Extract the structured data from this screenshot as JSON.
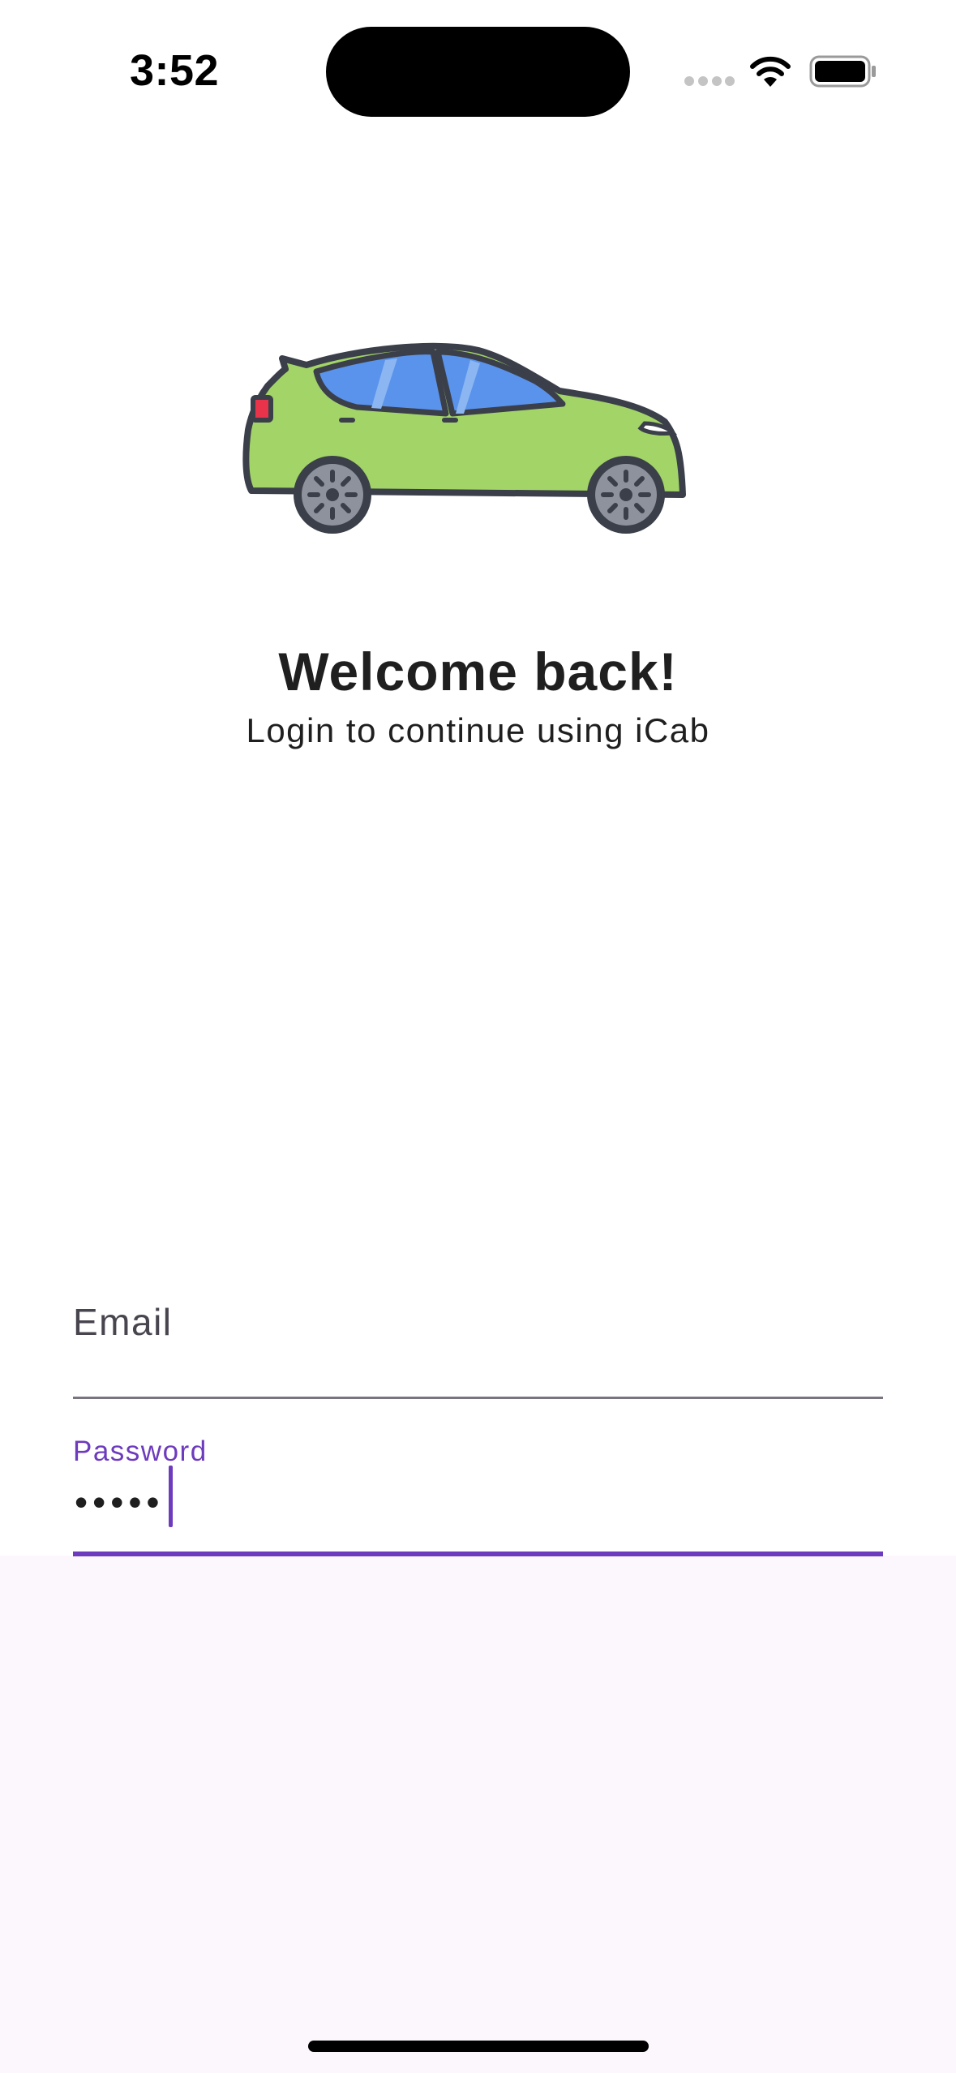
{
  "status_bar": {
    "time": "3:52",
    "wifi_icon": "wifi-icon",
    "battery_icon": "battery-icon"
  },
  "illustration": {
    "icon": "car-icon",
    "colors": {
      "body": "#a2d468",
      "windows": "#5a93ec",
      "outline": "#3b3f4a",
      "tail_light": "#e8334a",
      "wheel": "#8e929c"
    }
  },
  "header": {
    "title": "Welcome back!",
    "subtitle": "Login to continue using iCab"
  },
  "form": {
    "email": {
      "label": "Email",
      "value": ""
    },
    "password": {
      "label": "Password",
      "masked_value": "•••••",
      "focused": true
    }
  },
  "theme": {
    "accent": "#6d3bbd",
    "lower_background": "#fcf7fc"
  }
}
